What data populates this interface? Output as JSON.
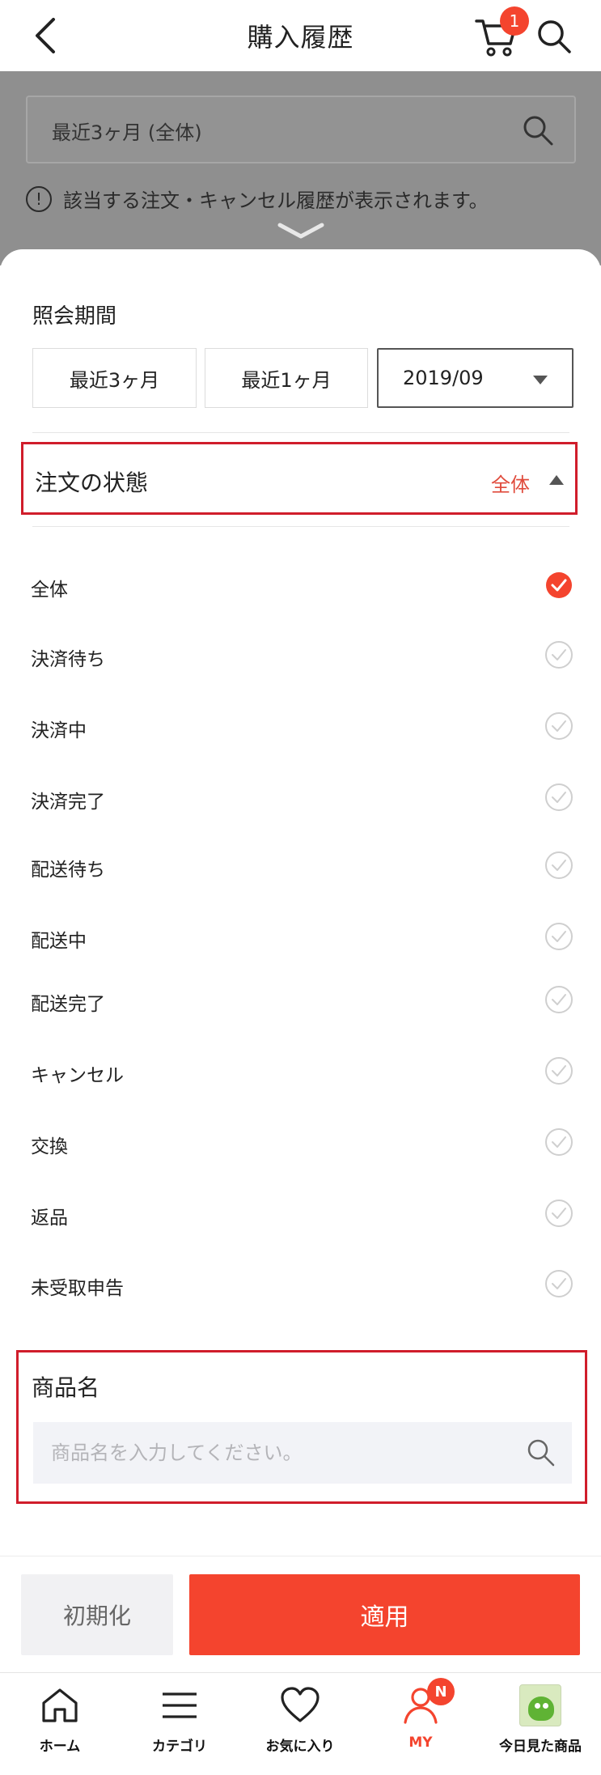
{
  "header": {
    "title": "購入履歴",
    "cart_count": "1"
  },
  "background": {
    "period_value": "最近3ヶ月 (全体)",
    "notice": "該当する注文・キャンセル履歴が表示されます。",
    "info_glyph": "!"
  },
  "period": {
    "title": "照会期間",
    "options": [
      "最近3ヶ月",
      "最近1ヶ月"
    ],
    "month_select": "2019/09"
  },
  "status": {
    "title": "注文の状態",
    "selected": "全体",
    "options": [
      {
        "label": "全体",
        "checked": true
      },
      {
        "label": "決済待ち",
        "checked": false
      },
      {
        "label": "決済中",
        "checked": false
      },
      {
        "label": "決済完了",
        "checked": false
      },
      {
        "label": "配送待ち",
        "checked": false
      },
      {
        "label": "配送中",
        "checked": false
      },
      {
        "label": "配送完了",
        "checked": false
      },
      {
        "label": "キャンセル",
        "checked": false
      },
      {
        "label": "交換",
        "checked": false
      },
      {
        "label": "返品",
        "checked": false
      },
      {
        "label": "未受取申告",
        "checked": false
      }
    ]
  },
  "product": {
    "title": "商品名",
    "placeholder": "商品名を入力してください。"
  },
  "actions": {
    "reset_label": "初期化",
    "apply_label": "適用"
  },
  "tabbar": {
    "items": [
      {
        "label": "ホーム",
        "icon": "home-icon"
      },
      {
        "label": "カテゴリ",
        "icon": "menu-icon"
      },
      {
        "label": "お気に入り",
        "icon": "heart-icon"
      },
      {
        "label": "MY",
        "icon": "user-icon",
        "badge": "N"
      },
      {
        "label": "今日見た商品",
        "icon": "recent-product-thumbnail"
      }
    ]
  },
  "colors": {
    "accent": "#f4442e",
    "highlight_border": "#d01d2b",
    "selected_text": "#e04b3c"
  }
}
